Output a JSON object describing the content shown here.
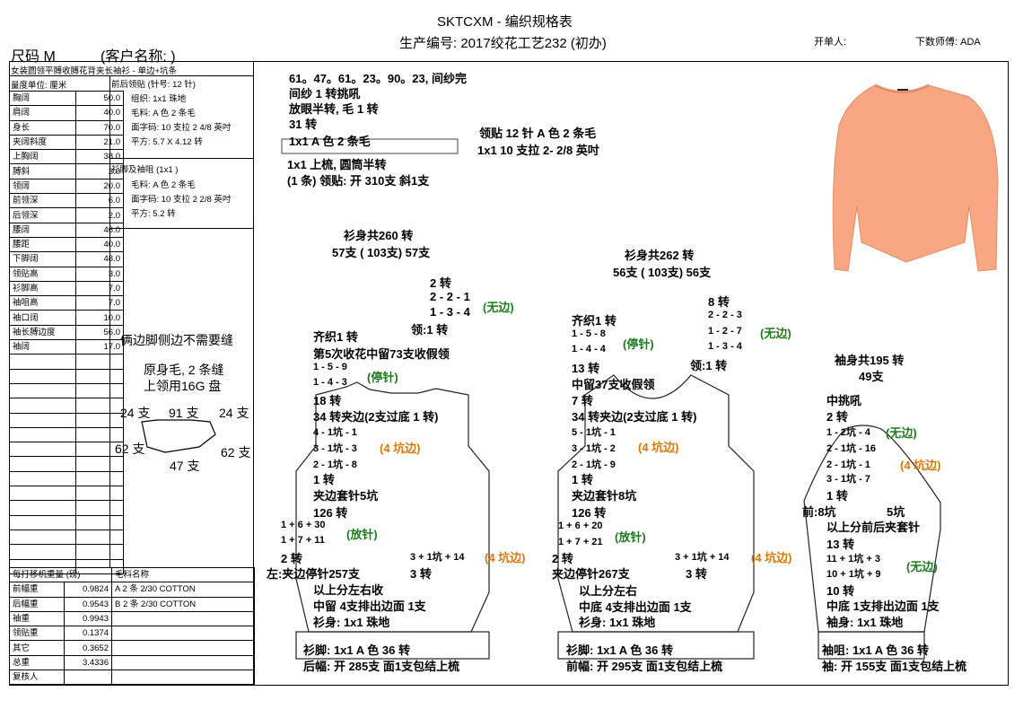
{
  "header": {
    "title": "SKTCXM - 编织规格表",
    "production_no": "生产编号: 2017绞花工艺232 (初办)",
    "size": "尺码  M",
    "client": "(客户名称:                )",
    "issuer": "开单人:",
    "pattern_master": "下数师傅: ADA"
  },
  "style_desc": "女装圆领平膊收膊花背夹长袖衫 - 单边+坑条",
  "unit_label": "量度单位: 厘米",
  "measurements": [
    {
      "label": "胸阔",
      "value": "50.0"
    },
    {
      "label": "肩阔",
      "value": "40.0"
    },
    {
      "label": "身长",
      "value": "70.0"
    },
    {
      "label": "夹阔斜度",
      "value": "21.0"
    },
    {
      "label": "上胸阔",
      "value": "38.0"
    },
    {
      "label": "膊斜",
      "value": "3.0"
    },
    {
      "label": "领阔",
      "value": "20.0"
    },
    {
      "label": "前领深",
      "value": "6.0"
    },
    {
      "label": "后领深",
      "value": "2.0"
    },
    {
      "label": "腰阔",
      "value": "46.0"
    },
    {
      "label": "腰距",
      "value": "40.0"
    },
    {
      "label": "下脚阔",
      "value": "48.0"
    },
    {
      "label": "领贴高",
      "value": "3.0"
    },
    {
      "label": "衫脚高",
      "value": "7.0"
    },
    {
      "label": "袖咀高",
      "value": "7.0"
    },
    {
      "label": "袖口阔",
      "value": "10.0"
    },
    {
      "label": "袖长膊边度",
      "value": "56.0"
    },
    {
      "label": "袖阔",
      "value": "17.0"
    }
  ],
  "specs": {
    "neck_title": "前后领贴 (针号: 12 针)",
    "neck_lines": [
      "组织: 1x1  珠地",
      "毛料: A 色 2 条毛",
      "面字码: 10 支拉 2 4/8 英吋",
      "平方: 5.7 X  4.12 转"
    ],
    "hem_title": "衫脚及袖咀 (1x1 )",
    "hem_lines": [
      "毛料: A 色 2 条毛",
      "面字码: 10 支拉 2 2/8 英吋",
      "平方: 5.2 转"
    ]
  },
  "notes": {
    "side": "俩边脚侧边不需要缝",
    "body1": "原身毛, 2 条缝",
    "body2": "上领用16G 盘",
    "n24a": "24 支",
    "n91": "91 支",
    "n24b": "24 支",
    "n62a": "62 支",
    "n62b": "62 支",
    "n47": "47 支"
  },
  "weights": {
    "title": "每打移机重量 (磅)",
    "yarn_title": "毛料名称",
    "rows": [
      {
        "label": "前幅重",
        "value": "0.9824",
        "yarn": "A  2 条 2/30 COTTON"
      },
      {
        "label": "后幅重",
        "value": "0.9543",
        "yarn": "B  2 条 2/30 COTTON"
      },
      {
        "label": "袖重",
        "value": "0.9943",
        "yarn": ""
      },
      {
        "label": "领贴重",
        "value": "0.1374",
        "yarn": ""
      },
      {
        "label": "其它",
        "value": "0.3652",
        "yarn": ""
      },
      {
        "label": "总重",
        "value": "3.4336",
        "yarn": ""
      },
      {
        "label": "复核人",
        "value": "",
        "yarn": ""
      }
    ]
  },
  "collar": {
    "l1": "61。47。61。23。90。23, 间纱完",
    "l2": "间纱 1 转挑吼",
    "l3": "放眼半转, 毛 1 转",
    "l4": "31 转",
    "l5": "1x1   A 色 2 条毛",
    "l6": "1x1 上梳, 圆筒半转",
    "l7": "(1 条) 领贴: 开 310支  斜1支",
    "r1": "领贴  12 针 A 色 2 条毛",
    "r2": "1x1   10 支拉 2- 2/8 英吋"
  },
  "back": {
    "total": "衫身共260 转",
    "needles": "57支 ( 103支) 57支",
    "n1": "2 转",
    "n2": "2 - 2 - 1",
    "n3": "1 - 3 - 4",
    "nb": "(无边)",
    "n4": "领:1 转",
    "a1": "齐织1 转",
    "a2": "第5次收花中留73支收假领",
    "a3": "1 - 5 - 9",
    "a4": "1 - 4 - 3",
    "ab": "(停针)",
    "a5": "18 转",
    "a6": "34 转夹边(2支过底 1 转)",
    "a7": "4 - 1坑 - 1",
    "a8": "3 - 1坑 - 3",
    "a9": "2 - 1坑 - 8",
    "a10": "(4 坑边)",
    "a11": "1 转",
    "a12": "夹边套针5坑",
    "a13": "126 转",
    "w1": "1 + 6 + 30",
    "w2": "1 + 7 + 11",
    "wb": "(放针)",
    "w3": "2 转",
    "s1": "3 + 1坑 + 14",
    "s2": "(4 坑边)",
    "s3": "3 转",
    "b1": "左:夹边停针257支",
    "b2": "以上分左右收",
    "b3": "中留 4支排出边面 1支",
    "b4": "衫身: 1x1  珠地",
    "h1": "衫脚: 1x1     A 色  36 转",
    "h2": "后幅: 开 285支  面1支包结上梳"
  },
  "front": {
    "total": "衫身共262 转",
    "needles": "56支 ( 103支) 56支",
    "n1": "8 转",
    "n2": "2 - 2 - 3",
    "n3": "1 - 2 - 7",
    "n4": "1 - 3 - 4",
    "nb": "(无边)",
    "n5": "领:1 转",
    "a1": "齐织1 转",
    "a3": "1 - 5 - 8",
    "a4": "1 - 4 - 4",
    "ab": "(停针)",
    "a5": "13 转",
    "a2": "中留37支收假领",
    "a6": "7 转",
    "a7": "34 转夹边(2支过底 1 转)",
    "a8": "5 - 1坑 - 1",
    "a9": "3 - 1坑 - 2",
    "a10": "2 - 1坑 - 9",
    "ak": "(4 坑边)",
    "a11": "1 转",
    "a12": "夹边套针8坑",
    "a13": "126 转",
    "w1": "1 + 6 + 20",
    "w2": "1 + 7 + 21",
    "wb": "(放针)",
    "w3": "2 转",
    "s1": "3 + 1坑 + 14",
    "s2": "(4 坑边)",
    "s3": "3 转",
    "b1": "夹边停针267支",
    "b2": "以上分左右",
    "b3": "中底 4支排出边面 1支",
    "b4": "衫身: 1x1  珠地",
    "h1": "衫脚: 1x1     A 色  36 转",
    "h2": "前幅: 开 295支  面1支包结上梳"
  },
  "sleeve": {
    "total": "袖身共195 转",
    "needles": "49支",
    "c1": "中挑吼",
    "c2": "2 转",
    "c3": "1 - 2坑 - 4",
    "cb": "(无边)",
    "c4": "2 - 1坑 - 16",
    "c5": "2 - 1坑 - 1",
    "c6": "3 - 1坑 - 7",
    "ck": "(4 坑边)",
    "c7": "1 转",
    "c8": "前:8坑",
    "c9": "5坑",
    "c10": "以上分前后夹套针",
    "c11": "13 转",
    "c12": "11 + 1坑 + 3",
    "c13": "10 + 1坑 + 9",
    "cw": "(无边)",
    "c14": "10 转",
    "c15": "中底 1支排出边面 1支",
    "c16": "袖身: 1x1  珠地",
    "h1": "袖咀: 1x1     A 色  36 转",
    "h2": "袖: 开 155支  面1支包结上梳"
  },
  "colors": {
    "green": "#1f7a1f",
    "orange": "#d9770b",
    "sweater": "#f7a882",
    "outline": "#2b4fb5"
  }
}
